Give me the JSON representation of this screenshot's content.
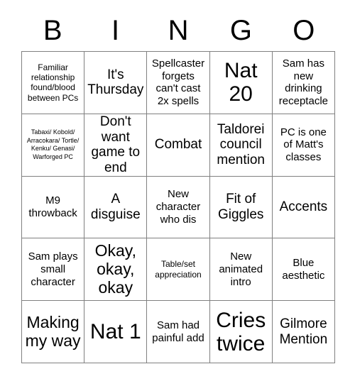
{
  "card": {
    "title": "BINGO",
    "header_letters": [
      "B",
      "I",
      "N",
      "G",
      "O"
    ],
    "columns": 5,
    "rows": 5,
    "colors": {
      "text": "#000000",
      "background": "#ffffff",
      "border": "#808080"
    },
    "cells": [
      {
        "text": "Familiar relationship found/blood between PCs",
        "size": "sm"
      },
      {
        "text": "It's Thursday",
        "size": "lg"
      },
      {
        "text": "Spellcaster forgets can't cast 2x spells",
        "size": "md"
      },
      {
        "text": "Nat 20",
        "size": "xxl"
      },
      {
        "text": "Sam has new drinking receptacle",
        "size": "md"
      },
      {
        "text": "Tabaxi/ Kobold/ Arracokara/ Tortle/ Kenku/ Genasi/ Warforged PC",
        "size": "xs"
      },
      {
        "text": "Don't want game to end",
        "size": "lg"
      },
      {
        "text": "Combat",
        "size": "lg"
      },
      {
        "text": "Taldorei council mention",
        "size": "lg"
      },
      {
        "text": "PC is one of Matt's classes",
        "size": "md"
      },
      {
        "text": "M9 throwback",
        "size": "md"
      },
      {
        "text": "A disguise",
        "size": "lg"
      },
      {
        "text": "New character who dis",
        "size": "md"
      },
      {
        "text": "Fit of Giggles",
        "size": "lg"
      },
      {
        "text": "Accents",
        "size": "lg"
      },
      {
        "text": "Sam plays small character",
        "size": "md"
      },
      {
        "text": "Okay, okay, okay",
        "size": "xl"
      },
      {
        "text": "Table/set appreciation",
        "size": "sm"
      },
      {
        "text": "New animated intro",
        "size": "md"
      },
      {
        "text": "Blue aesthetic",
        "size": "md"
      },
      {
        "text": "Making my way",
        "size": "xl"
      },
      {
        "text": "Nat 1",
        "size": "xxl"
      },
      {
        "text": "Sam had painful add",
        "size": "md"
      },
      {
        "text": "Cries twice",
        "size": "xxl"
      },
      {
        "text": "Gilmore Mention",
        "size": "lg"
      }
    ]
  }
}
